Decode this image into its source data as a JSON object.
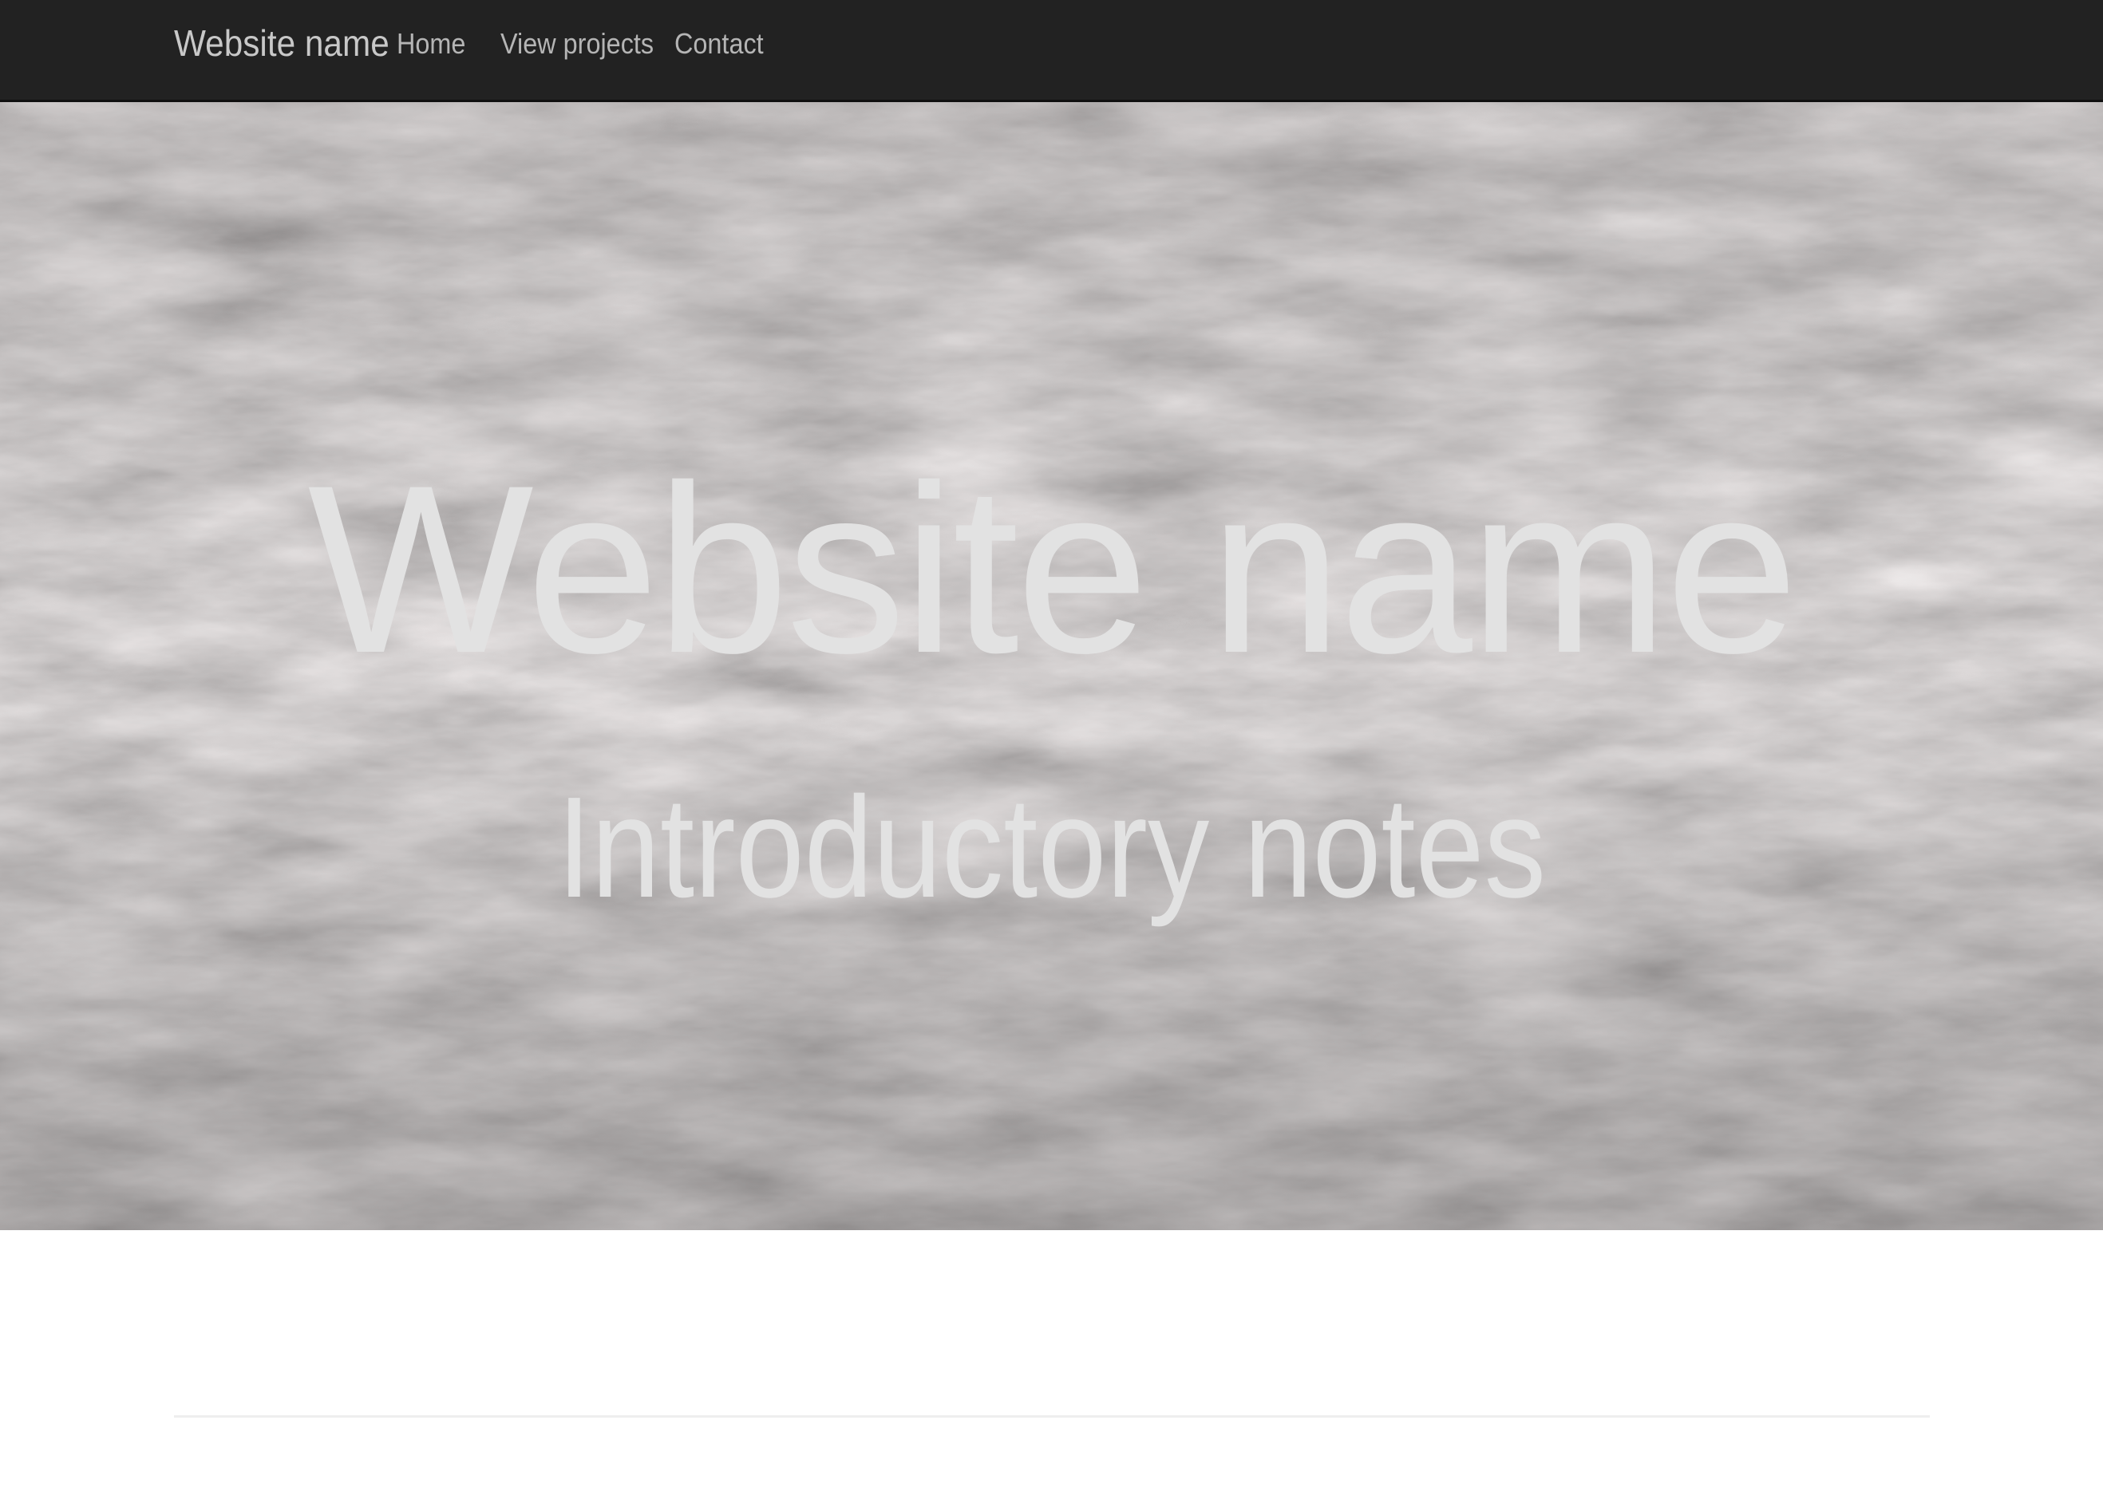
{
  "navbar": {
    "brand": "Website name",
    "links": [
      {
        "label": "Home"
      },
      {
        "label": "View projects"
      },
      {
        "label": "Contact"
      }
    ],
    "background_color": "#222222"
  },
  "hero": {
    "title": "Website name",
    "subtitle": "Introductory notes",
    "background": "ocean-waves-photo",
    "text_color": "#e2e2e2"
  }
}
